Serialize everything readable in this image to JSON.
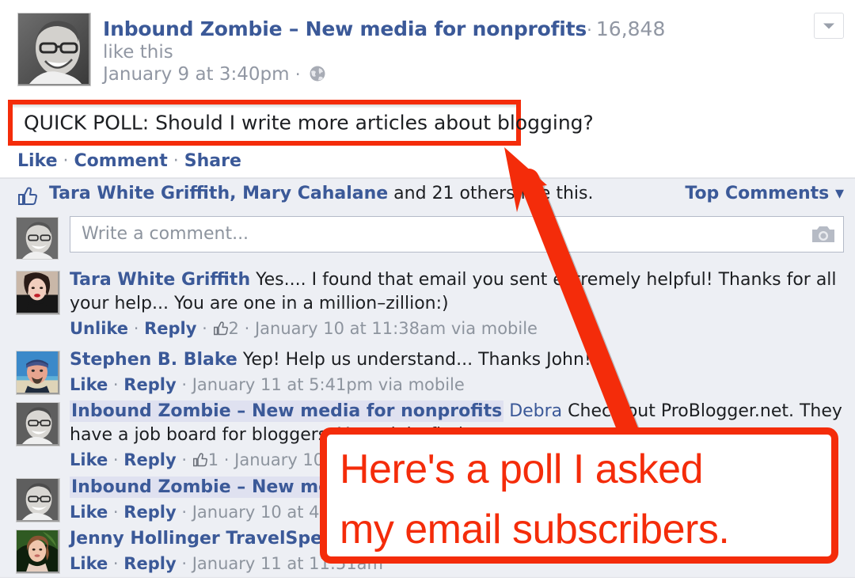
{
  "post": {
    "page_name": "Inbound Zombie – New media for nonprofits",
    "separator": "·",
    "like_count": "16,848",
    "like_this_label": "like this",
    "timestamp": "January 9 at 3:40pm",
    "privacy_icon": "globe-icon",
    "dropdown_icon": "chevron-down-icon",
    "body_text": "QUICK POLL: Should I write more articles about blogging?"
  },
  "actions": {
    "like": "Like",
    "comment": "Comment",
    "share": "Share",
    "dot": "·"
  },
  "likes_row": {
    "thumb_icon": "thumbs-up-icon",
    "names": "Tara White Griffith, Mary Cahalane",
    "suffix": " and 21 others like this.",
    "others_count": "21 others",
    "sort_label": "Top Comments",
    "sort_caret": "▾"
  },
  "composer": {
    "placeholder": "Write a comment...",
    "camera_icon": "camera-icon"
  },
  "comments": [
    {
      "name": "Tara White Griffith",
      "name_highlighted": false,
      "mention": "",
      "text": "Yes.... I found that email you sent extremely helpful! Thanks for all your help... You are one in a million–zillion:)",
      "like_action": "Unlike",
      "reply_action": "Reply",
      "like_count": "2",
      "has_like_count": true,
      "timestamp": "January 10 at 11:38am via mobile",
      "dot": "·"
    },
    {
      "name": "Stephen B. Blake",
      "name_highlighted": false,
      "mention": "",
      "text": "Yep! Help us understand... Thanks John!",
      "like_action": "Like",
      "reply_action": "Reply",
      "like_count": "",
      "has_like_count": false,
      "timestamp": "January 11 at 5:41pm via mobile",
      "dot": "·"
    },
    {
      "name": "Inbound Zombie – New media for nonprofits",
      "name_highlighted": true,
      "mention": "Debra",
      "text": "Check out ProBlogger.net. They have a job board for bloggers. You might find",
      "like_action": "Like",
      "reply_action": "Reply",
      "like_count": "1",
      "has_like_count": true,
      "timestamp": "January 10 at 4",
      "dot": "·"
    },
    {
      "name": "Inbound Zombie – New media fo",
      "name_highlighted": true,
      "mention": "",
      "text": "",
      "like_action": "Like",
      "reply_action": "Reply",
      "like_count": "",
      "has_like_count": false,
      "timestamp": "January 10 at 4:00pm",
      "dot": "·"
    },
    {
      "name": "Jenny Hollinger TravelSpecialist",
      "name_highlighted": false,
      "mention": "",
      "text": "",
      "like_action": "Like",
      "reply_action": "Reply",
      "like_count": "",
      "has_like_count": false,
      "timestamp": "January 11 at 11:51am",
      "dot": "·"
    }
  ],
  "annotation": {
    "callout_line1": "Here's a poll I asked",
    "callout_line2": "my email subscribers.",
    "arrow_icon": "red-arrow-icon",
    "accent_color": "#f42c0a"
  }
}
